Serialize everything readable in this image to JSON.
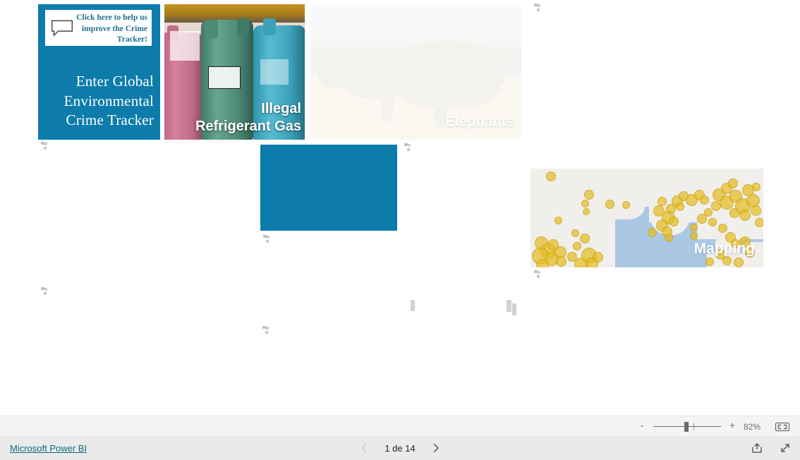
{
  "report": {
    "tiles": [
      {
        "id": "enter-tracker",
        "feedback_label": "Click here to help us improve the Crime Tracker!",
        "title": "Enter Global Environmental Crime Tracker",
        "bg_color": "#0d7cab",
        "icon": "speech-bubble-icon"
      },
      {
        "id": "refrigerant-gas",
        "title_line1": "Illegal",
        "title_line2": "Refrigerant Gas",
        "image": "photo-of-refrigerant-gas-cylinders"
      },
      {
        "id": "elephants",
        "title": "Elephants",
        "image": "photo-of-elephants-on-savanna"
      },
      {
        "id": "blank-blue",
        "title": "",
        "bg_color": "#0d7cab"
      },
      {
        "id": "mapping",
        "title": "Mapping",
        "image": "world-map-with-yellow-incident-clusters"
      }
    ]
  },
  "zoombar": {
    "minus_label": "-",
    "plus_label": "+",
    "zoom_level": "82%",
    "fit_to_page_icon": "fit-to-page-icon"
  },
  "statusbar": {
    "brand_link": "Microsoft Power BI",
    "prev_icon": "chevron-left-icon",
    "next_icon": "chevron-right-icon",
    "page_label": "1 de 14",
    "share_icon": "share-icon",
    "fullscreen_icon": "fullscreen-icon"
  }
}
